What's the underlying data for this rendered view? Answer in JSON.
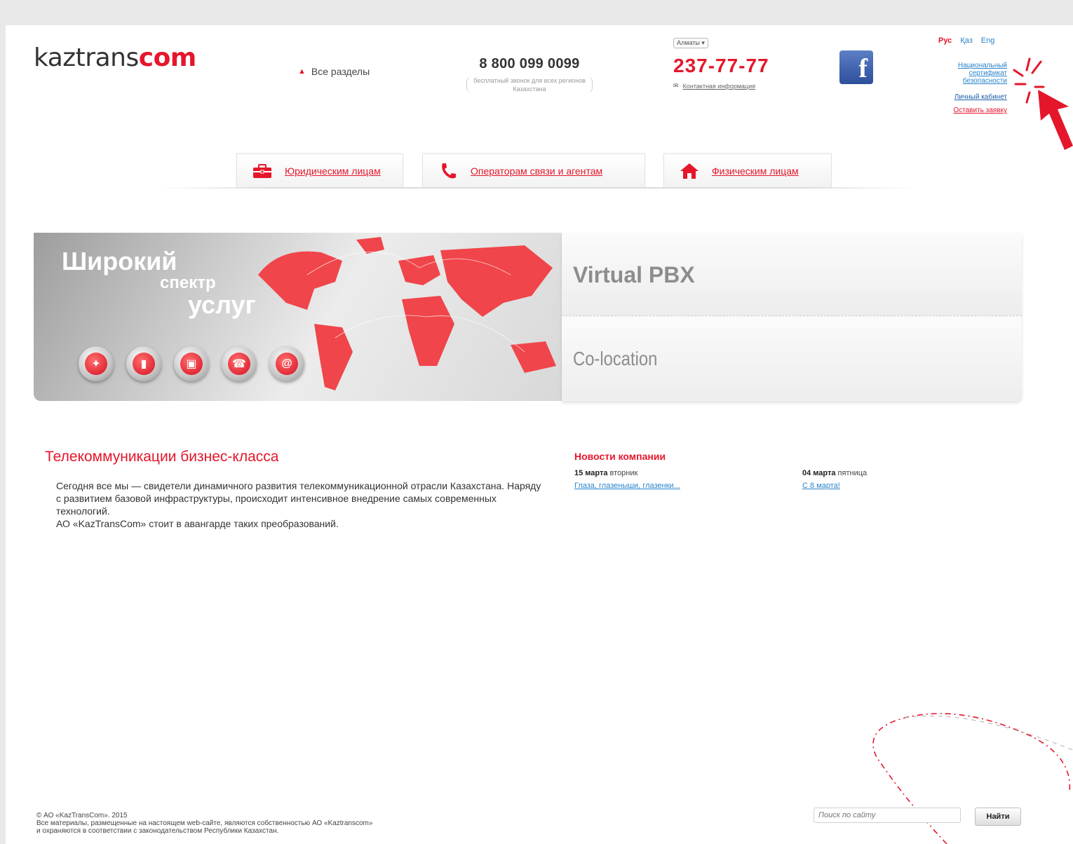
{
  "header": {
    "logo_main": "kaztrans",
    "logo_accent": "com",
    "all_sections": "Все разделы",
    "free_phone": "8 800 099 0099",
    "free_phone_note": "бесплатный звонок для всех регионов Казахстана",
    "city": "Алматы",
    "city_phone": "237-77-77",
    "contact_info": "Контактная информация",
    "facebook_glyph": "f",
    "languages": [
      "Рус",
      "Қаз",
      "Eng"
    ],
    "certificate_link": "Национальный сертификат безопасности",
    "cabinet_link": "Личный кабинет",
    "apply_link": "Оставить заявку"
  },
  "tabs": [
    {
      "label": "Юридическим лицам",
      "icon": "briefcase-icon"
    },
    {
      "label": "Операторам связи и агентам",
      "icon": "phone-handset-icon"
    },
    {
      "label": "Физическим лицам",
      "icon": "house-icon"
    }
  ],
  "banner": {
    "line1": "Широкий",
    "line2": "спектр",
    "line3": "услуг",
    "services": [
      "satellite-icon",
      "mobile-icon",
      "computer-icon",
      "telephone-icon",
      "at-icon"
    ]
  },
  "side_panel": {
    "items": [
      "Virtual PBX",
      "Co-location"
    ]
  },
  "main": {
    "title": "Телекоммуникации бизнес-класса",
    "paragraph1": "Сегодня все мы — свидетели динамичного развития телекоммуникационной отрасли Казахстана. Наряду с развитием базовой инфраструктуры, происходит интенсивное внедрение самых современных технологий.",
    "paragraph2": "АО «KazTransCom» стоит в авангарде таких преобразований."
  },
  "news": {
    "title": "Новости компании",
    "items": [
      {
        "date": "15 марта",
        "weekday": "вторник",
        "link": "Глаза, глазеныши, глазенки..."
      },
      {
        "date": "04 марта",
        "weekday": "пятница",
        "link": "С 8 марта!"
      }
    ]
  },
  "footer": {
    "copyright": "© АО «KazTransCom». 2015",
    "rights_line1": "Все материалы, размещенные на настоящем web-сайте, являются собственностью АО «Kaztranscom»",
    "rights_line2": "и охраняются в соответствии с законодательством Республики Казахстан."
  },
  "search": {
    "placeholder": "Поиск по сайту",
    "button": "Найти"
  },
  "colors": {
    "accent": "#e5162b",
    "link": "#2a83c9"
  }
}
